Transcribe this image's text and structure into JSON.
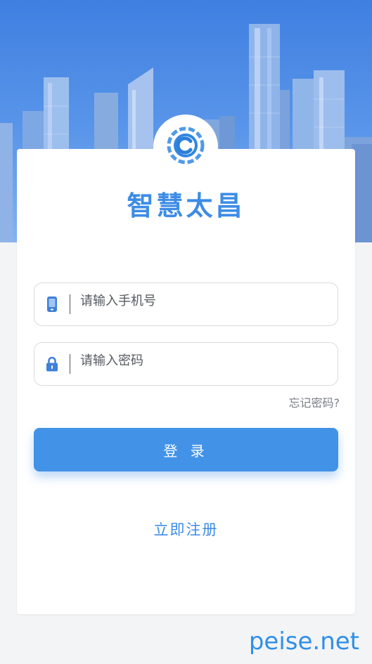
{
  "app": {
    "title": "智慧太昌"
  },
  "login_form": {
    "phone_placeholder": "请输入手机号",
    "password_placeholder": "请输入密码",
    "forgot_password": "忘记密码?",
    "login_button": "登 录",
    "register_link": "立即注册"
  },
  "watermark": "peise.net",
  "colors": {
    "accent": "#3d8ce6",
    "button": "#4293e8",
    "hero_sky": "#4a86e4"
  },
  "icons": {
    "logo": "c-swirl-logo-icon",
    "phone": "phone-icon",
    "password": "lock-icon"
  }
}
